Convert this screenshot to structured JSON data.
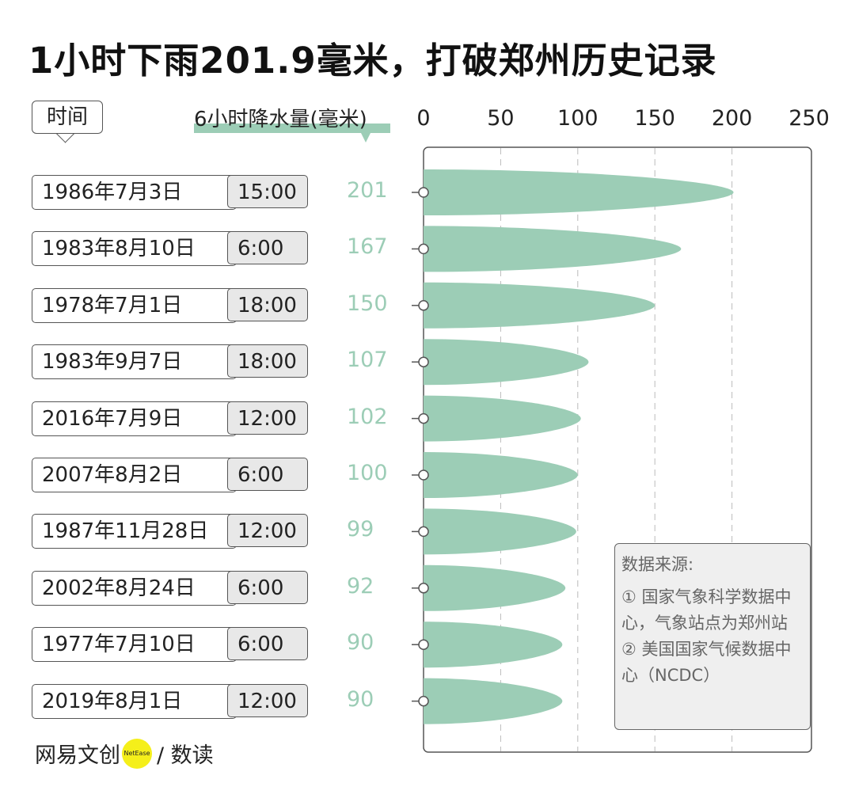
{
  "chart_data": {
    "type": "bar",
    "title": "1小时下雨201.9毫米，打破郑州历史记录",
    "xlabel": "6小时降水量(毫米)",
    "category_header": "时间",
    "xlim": [
      0,
      250
    ],
    "xticks": [
      "0",
      "50",
      "100",
      "150",
      "200",
      "250"
    ],
    "grid": "vertical-dashed",
    "color": "#9ccdb6",
    "rows": [
      {
        "date": "1986年7月3日",
        "time": "15:00",
        "value": 201
      },
      {
        "date": "1983年8月10日",
        "time": "6:00",
        "value": 167
      },
      {
        "date": "1978年7月1日",
        "time": "18:00",
        "value": 150
      },
      {
        "date": "1983年9月7日",
        "time": "18:00",
        "value": 107
      },
      {
        "date": "2016年7月9日",
        "time": "12:00",
        "value": 102
      },
      {
        "date": "2007年8月2日",
        "time": "6:00",
        "value": 100
      },
      {
        "date": "1987年11月28日",
        "time": "12:00",
        "value": 99
      },
      {
        "date": "2002年8月24日",
        "time": "6:00",
        "value": 92
      },
      {
        "date": "1977年7月10日",
        "time": "6:00",
        "value": 90
      },
      {
        "date": "2019年8月1日",
        "time": "12:00",
        "value": 90
      }
    ]
  },
  "source": {
    "heading": "数据来源:",
    "line1": "① 国家气象科学数据中心，气象站点为郑州站",
    "line2": "② 美国国家气候数据中心（NCDC）"
  },
  "logo": {
    "left": "网易文创",
    "badge": "NetEase",
    "right": "/ 数读"
  }
}
